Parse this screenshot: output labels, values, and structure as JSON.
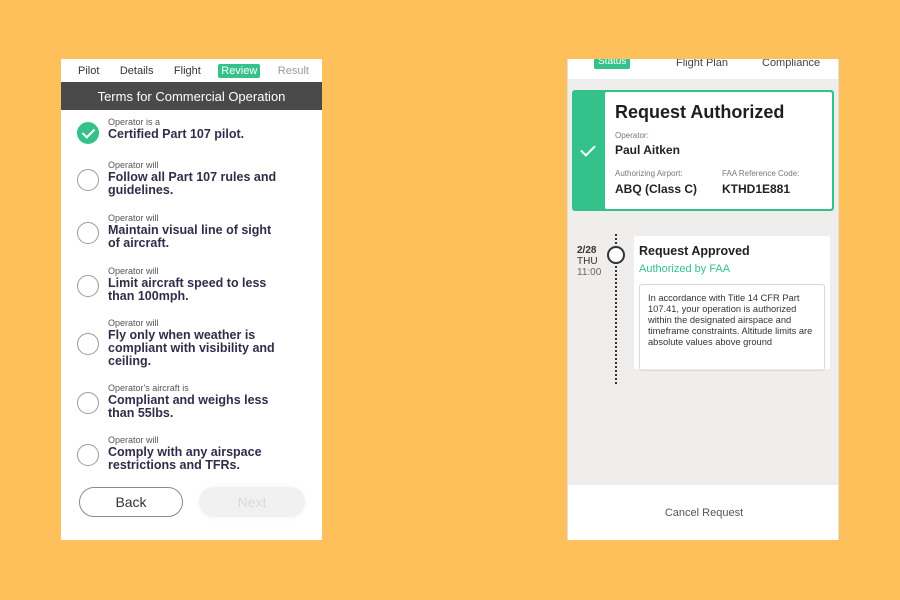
{
  "left": {
    "steps": [
      {
        "label": "Pilot",
        "state": "normal"
      },
      {
        "label": "Details",
        "state": "normal"
      },
      {
        "label": "Flight",
        "state": "normal"
      },
      {
        "label": "Review",
        "state": "active"
      },
      {
        "label": "Result",
        "state": "disabled"
      }
    ],
    "header": "Terms for Commercial Operation",
    "terms": [
      {
        "sub": "Operator is a",
        "main": "Certified Part 107 pilot.",
        "checked": true
      },
      {
        "sub": "Operator will",
        "main": "Follow all Part 107 rules and guidelines.",
        "checked": false
      },
      {
        "sub": "Operator will",
        "main": "Maintain visual line of sight of aircraft.",
        "checked": false
      },
      {
        "sub": "Operator will",
        "main": "Limit aircraft speed to less than 100mph.",
        "checked": false
      },
      {
        "sub": "Operator will",
        "main": "Fly only when weather is compliant with visibility and ceiling.",
        "checked": false
      },
      {
        "sub": "Operator's aircraft is",
        "main": "Compliant and weighs less than 55lbs.",
        "checked": false
      },
      {
        "sub": "Operator will",
        "main": "Comply with any airspace restrictions and TFRs.",
        "checked": false
      }
    ],
    "back_label": "Back",
    "next_label": "Next"
  },
  "right": {
    "tabs": [
      "Status",
      "Flight Plan",
      "Compliance"
    ],
    "auth": {
      "title": "Request Authorized",
      "operator_label": "Operator:",
      "operator_name": "Paul Aitken",
      "airport_label": "Authorizing Airport:",
      "airport_value": "ABQ (Class C)",
      "faa_label": "FAA Reference Code:",
      "faa_value": "KTHD1E881"
    },
    "timeline": {
      "date": "2/28",
      "day": "THU",
      "time": "11:00"
    },
    "approved": {
      "title": "Request Approved",
      "subtitle": "Authorized by FAA",
      "notice": "In accordance with Title 14 CFR Part 107.41, your operation is authorized within the designated airspace and timeframe constraints. Altitude limits are absolute values above ground"
    },
    "cancel_label": "Cancel Request"
  },
  "colors": {
    "background": "#fdc05a",
    "accent": "#35c28a",
    "header_dark": "#4a4a4a"
  }
}
